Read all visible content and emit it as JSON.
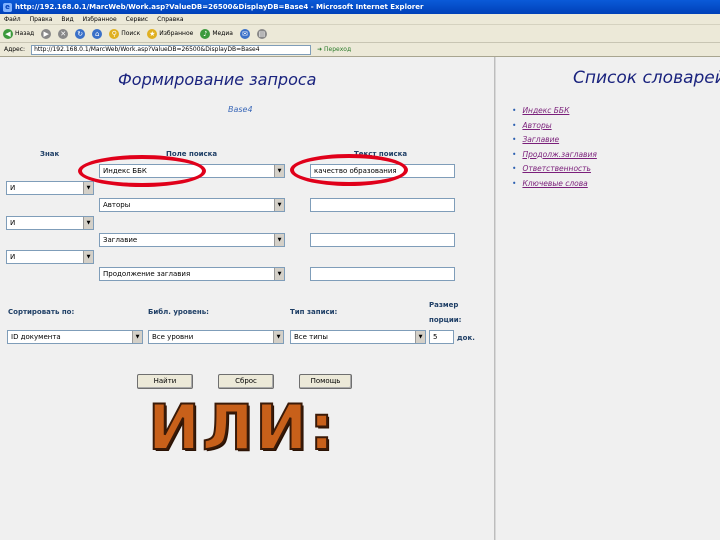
{
  "window": {
    "title": "http://192.168.0.1/MarcWeb/Work.asp?ValueDB=26500&DisplayDB=Base4 - Microsoft Internet Explorer"
  },
  "menu": [
    "Файл",
    "Правка",
    "Вид",
    "Избранное",
    "Сервис",
    "Справка"
  ],
  "toolbar": {
    "back": "Назад",
    "search": "Поиск",
    "favorites": "Избранное",
    "media": "Медиа"
  },
  "address": {
    "label": "Адрес:",
    "url": "http://192.168.0.1/MarcWeb/Work.asp?ValueDB=26500&DisplayDB=Base4",
    "go": "Переход"
  },
  "form": {
    "title": "Формирование запроса",
    "db_name": "Base4",
    "headers": {
      "sign": "Знак",
      "field": "Поле поиска",
      "term": "Текст поиска"
    },
    "rows": [
      {
        "field": "Индекс ББК",
        "term": "качество образования"
      },
      {
        "sign": "И",
        "field": "Авторы",
        "term": ""
      },
      {
        "sign": "И",
        "field": "Заглавие",
        "term": ""
      },
      {
        "sign": "И",
        "field": "Продолжение заглавия",
        "term": ""
      }
    ],
    "sort_label": "Сортировать по:",
    "sort_value": "ID документа",
    "level_label": "Библ. уровень:",
    "level_value": "Все уровни",
    "type_label": "Тип записи:",
    "type_value": "Все типы",
    "portion_label_1": "Размер",
    "portion_label_2": "порции:",
    "portion_value": "5",
    "portion_unit": "док.",
    "buttons": {
      "find": "Найти",
      "reset": "Сброс",
      "help": "Помощь"
    }
  },
  "dictionary": {
    "title": "Список словарей",
    "items": [
      "Индекс ББК",
      "Авторы",
      "Заглавие",
      "Продолж.заглавия",
      "Ответственность",
      "Ключевые слова"
    ]
  },
  "overlay": {
    "text": "ИЛИ:",
    "ellipse_color": "#e0001a",
    "text_color": "#c8601a"
  }
}
